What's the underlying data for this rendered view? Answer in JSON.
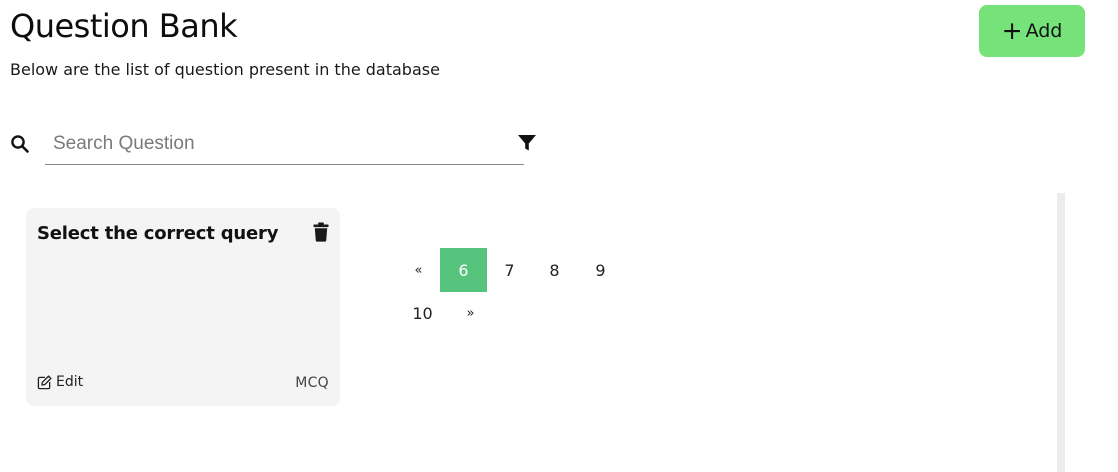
{
  "header": {
    "title": "Question Bank",
    "subtitle": "Below are the list of question present in the database",
    "add_label": "Add"
  },
  "search": {
    "placeholder": "Search Question",
    "value": ""
  },
  "questions": [
    {
      "title": "Select the correct query",
      "edit_label": "Edit",
      "type": "MCQ"
    }
  ],
  "pagination": {
    "prev_label": "«",
    "next_label": "»",
    "pages": [
      "6",
      "7",
      "8",
      "9",
      "10"
    ],
    "active_page": "6"
  },
  "colors": {
    "add_button": "#76e27a",
    "active_page": "#56c47c",
    "card_background": "#f4f4f4"
  }
}
